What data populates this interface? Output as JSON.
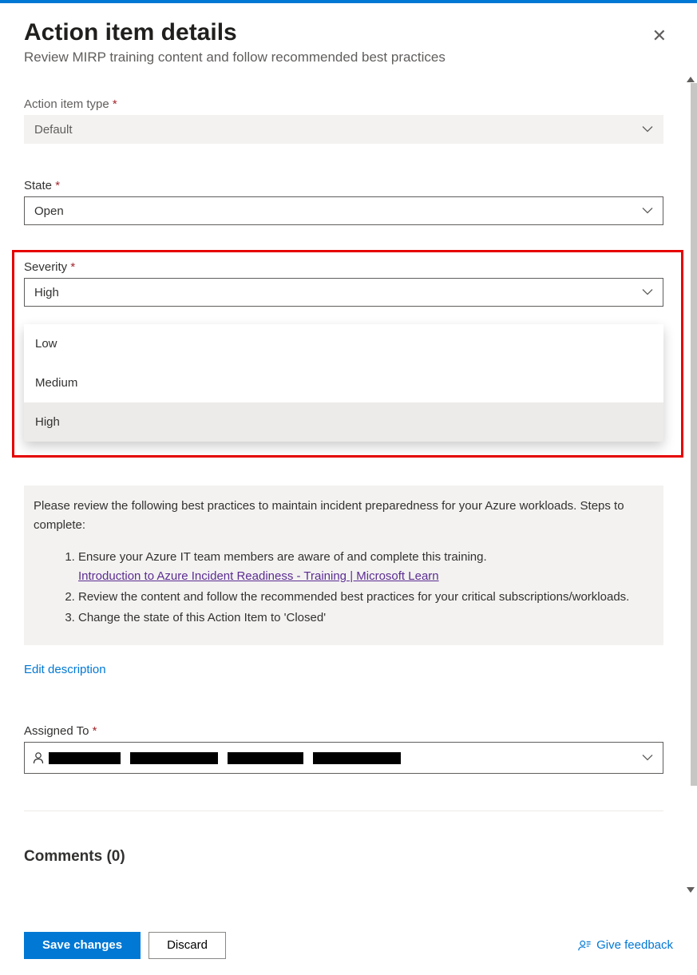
{
  "header": {
    "title": "Action item details",
    "subtitle": "Review MIRP training content and follow recommended best practices",
    "close_glyph": "✕"
  },
  "fields": {
    "type": {
      "label": "Action item type",
      "value": "Default"
    },
    "state": {
      "label": "State",
      "value": "Open"
    },
    "severity": {
      "label": "Severity",
      "value": "High",
      "options": [
        "Low",
        "Medium",
        "High"
      ]
    },
    "description": {
      "intro": "Please review the following best practices to maintain incident preparedness for your Azure workloads. Steps to complete:",
      "step1": "Ensure your Azure IT team members are aware of and complete this training.",
      "link_text": "Introduction to Azure Incident Readiness - Training | Microsoft Learn",
      "step2": "Review the content and follow the recommended best practices for your critical subscriptions/workloads.",
      "step3": "Change the state of this Action Item to 'Closed'",
      "edit_label": "Edit description"
    },
    "assigned": {
      "label": "Assigned To"
    }
  },
  "comments": {
    "header": "Comments (0)"
  },
  "footer": {
    "save": "Save changes",
    "discard": "Discard",
    "feedback": "Give feedback"
  }
}
